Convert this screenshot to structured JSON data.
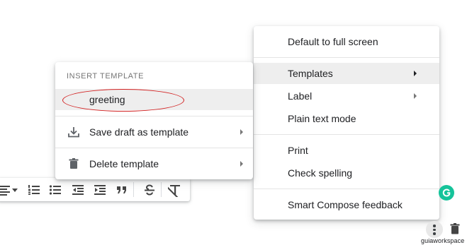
{
  "toolbar": {
    "icons": [
      "align-left-icon",
      "caret-down-icon",
      "numbered-list-icon",
      "bulleted-list-icon",
      "indent-less-icon",
      "indent-more-icon",
      "quote-icon",
      "strikethrough-icon",
      "remove-formatting-icon"
    ]
  },
  "more_options_menu": {
    "items": [
      {
        "label": "Default to full screen"
      },
      {
        "label": "Templates",
        "has_submenu": true,
        "selected": true
      },
      {
        "label": "Label",
        "has_submenu": true
      },
      {
        "label": "Plain text mode"
      },
      {
        "label": "Print"
      },
      {
        "label": "Check spelling"
      },
      {
        "label": "Smart Compose feedback"
      }
    ]
  },
  "templates_menu": {
    "section_header": "INSERT TEMPLATE",
    "templates": [
      {
        "label": "greeting",
        "highlighted": true
      }
    ],
    "actions": [
      {
        "label": "Save draft as template",
        "icon": "download-icon",
        "has_submenu": true
      },
      {
        "label": "Delete template",
        "icon": "trash-icon",
        "has_submenu": true
      }
    ]
  },
  "annotation": {
    "shape": "ellipse",
    "color": "#d21f1f",
    "target": "greeting"
  },
  "compose_actions": {
    "grammarly_icon": "grammarly-icon",
    "more_options_icon": "more-vertical-icon",
    "discard_icon": "trash-icon"
  },
  "watermark": "guiaworkspace",
  "colors": {
    "menu_selected_bg": "#eeeeee",
    "grammarly": "#15c39a",
    "text": "#202124",
    "header_text": "#757575"
  }
}
